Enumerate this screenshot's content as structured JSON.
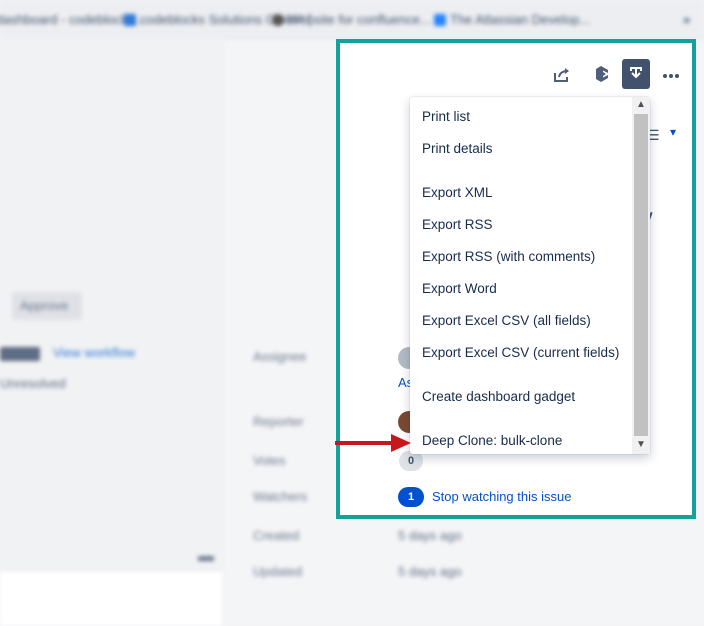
{
  "bookmarks": [
    {
      "label": "dashboard - codeblocks..."
    },
    {
      "label": "codeblocks Solutions GmbH ("
    },
    {
      "label": "Website for confluence..."
    },
    {
      "label": "The Atlassian Develop..."
    }
  ],
  "background": {
    "approve_label": "Approve",
    "view_workflow": "View workflow",
    "resolution": "Unresolved",
    "fields": [
      {
        "label": "Assignee"
      },
      {
        "label": "Reporter"
      },
      {
        "label": "Votes"
      },
      {
        "label": "Watchers"
      },
      {
        "label": "Created",
        "value": "5 days ago"
      },
      {
        "label": "Updated",
        "value": "5 days ago"
      }
    ]
  },
  "toolbar": {
    "icons": [
      "share-icon",
      "clone-app-icon",
      "export-icon",
      "more-icon"
    ]
  },
  "dropdown": {
    "items": [
      {
        "label": "Print list"
      },
      {
        "label": "Print details"
      },
      {
        "label": "Export XML"
      },
      {
        "label": "Export RSS"
      },
      {
        "label": "Export RSS (with comments)"
      },
      {
        "label": "Export Word"
      },
      {
        "label": "Export Excel CSV (all fields)"
      },
      {
        "label": "Export Excel CSV (current fields)"
      },
      {
        "label": "Create dashboard gadget"
      },
      {
        "label": "Deep Clone: bulk-clone"
      }
    ]
  },
  "details": {
    "assign_link": "As",
    "votes_count": "0",
    "watchers_count": "1",
    "watch_link": "Stop watching this issue"
  },
  "colors": {
    "highlight_frame": "#15a09a",
    "arrow": "#c8161d",
    "link": "#0052cc"
  }
}
